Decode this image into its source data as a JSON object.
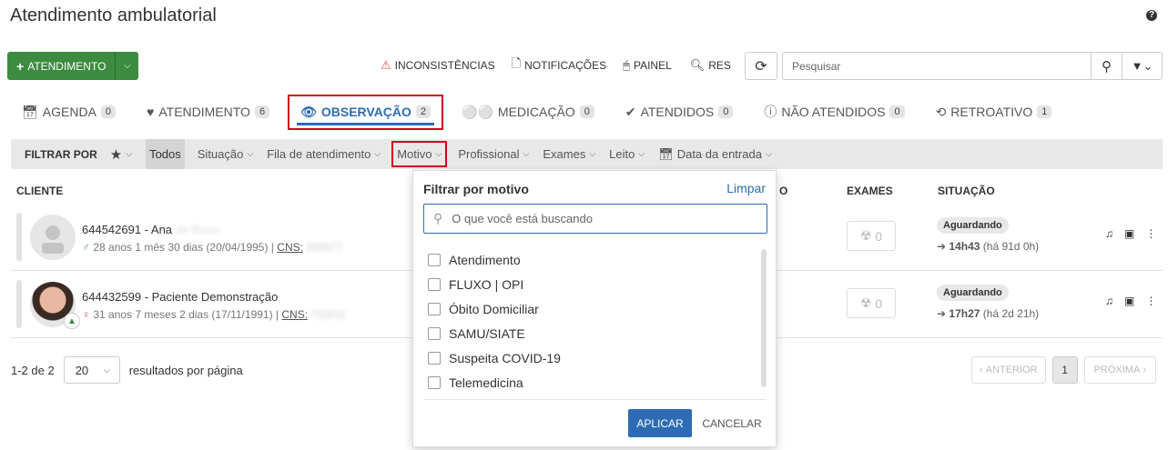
{
  "page": {
    "title": "Atendimento ambulatorial",
    "help": "?"
  },
  "actions": {
    "new_atendimento": "ATENDIMENTO",
    "inconsistencias": "INCONSISTÊNCIAS",
    "notificacoes": "NOTIFICAÇÕES",
    "painel": "PAINEL",
    "res": "RES",
    "search_placeholder": "Pesquisar"
  },
  "tabs": [
    {
      "label": "AGENDA",
      "count": "0",
      "icon": "calendar-icon"
    },
    {
      "label": "ATENDIMENTO",
      "count": "6",
      "icon": "heartbeat-icon"
    },
    {
      "label": "OBSERVAÇÃO",
      "count": "2",
      "icon": "eye-icon",
      "active": true
    },
    {
      "label": "MEDICAÇÃO",
      "count": "0",
      "icon": "binoculars-icon"
    },
    {
      "label": "ATENDIDOS",
      "count": "0",
      "icon": "check-circle-icon"
    },
    {
      "label": "NÃO ATENDIDOS",
      "count": "0",
      "icon": "info-circle-icon"
    },
    {
      "label": "RETROATIVO",
      "count": "1",
      "icon": "history-icon"
    }
  ],
  "filter_bar": {
    "label": "FILTRAR POR",
    "todos": "Todos",
    "items": [
      "Situação",
      "Fila de atendimento",
      "Motivo",
      "Profissional",
      "Exames",
      "Leito",
      "Data da entrada"
    ]
  },
  "table": {
    "headers": {
      "cliente": "CLIENTE",
      "obs": "O",
      "exames": "EXAMES",
      "situacao": "SITUAÇÃO"
    },
    "rows": [
      {
        "name": "644542691 - Ana",
        "name_blurred": "de Rosa",
        "sex": "♂",
        "info": "28 anos 1 mês 30 dias (20/04/1995) |",
        "cns_label": "CNS:",
        "cns_blurred": "200677",
        "exams": "0",
        "status": "Aguardando",
        "time": "14h43",
        "time_suffix": "(há 91d 0h)"
      },
      {
        "name": "644432599 - Paciente Demonstração",
        "name_blurred": "",
        "sex": "♀",
        "info": "31 anos 7 meses 2 dias (17/11/1991) |",
        "cns_label": "CNS:",
        "cns_blurred": "722011",
        "exams": "0",
        "status": "Aguardando",
        "time": "17h27",
        "time_suffix": "(há 2d 21h)"
      }
    ]
  },
  "pagination": {
    "range": "1-2 de 2",
    "per_page": "20",
    "per_page_label": "resultados por página",
    "prev": "ANTERIOR",
    "page": "1",
    "next": "PRÓXIMA"
  },
  "popup": {
    "title": "Filtrar por motivo",
    "clear": "Limpar",
    "search_placeholder": "O que você está buscando",
    "options": [
      "Atendimento",
      "FLUXO | OPI",
      "Óbito Domiciliar",
      "SAMU/SIATE",
      "Suspeita COVID-19",
      "Telemedicina"
    ],
    "apply": "APLICAR",
    "cancel": "CANCELAR"
  },
  "colors": {
    "primary": "#2d6cb5",
    "success": "#3d8b40",
    "highlight": "#d0021b"
  }
}
